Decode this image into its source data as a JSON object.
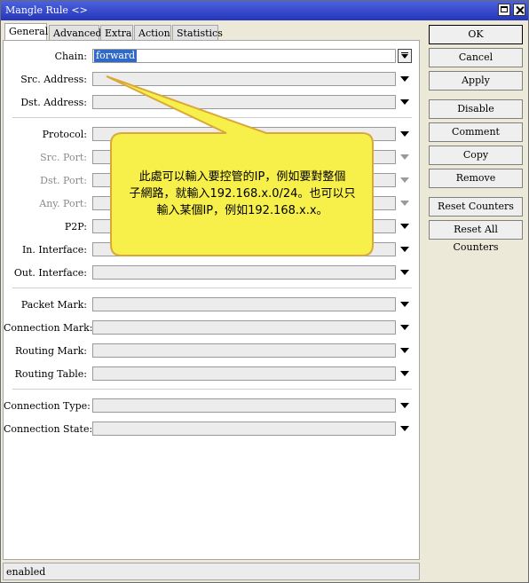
{
  "window": {
    "title": "Mangle Rule <>",
    "title_color": "#2e43cc"
  },
  "tabs": [
    {
      "label": "General",
      "active": true
    },
    {
      "label": "Advanced",
      "active": false
    },
    {
      "label": "Extra",
      "active": false
    },
    {
      "label": "Action",
      "active": false
    },
    {
      "label": "Statistics",
      "active": false
    }
  ],
  "fields": {
    "chain": {
      "label": "Chain:",
      "value": "forward"
    },
    "src_address": {
      "label": "Src. Address:"
    },
    "dst_address": {
      "label": "Dst. Address:"
    },
    "protocol": {
      "label": "Protocol:"
    },
    "src_port": {
      "label": "Src. Port:"
    },
    "dst_port": {
      "label": "Dst. Port:"
    },
    "any_port": {
      "label": "Any. Port:"
    },
    "p2p": {
      "label": "P2P:"
    },
    "in_interface": {
      "label": "In. Interface:"
    },
    "out_interface": {
      "label": "Out. Interface:"
    },
    "packet_mark": {
      "label": "Packet Mark:"
    },
    "connection_mark": {
      "label": "Connection Mark:"
    },
    "routing_mark": {
      "label": "Routing Mark:"
    },
    "routing_table": {
      "label": "Routing Table:"
    },
    "connection_type": {
      "label": "Connection Type:"
    },
    "connection_state": {
      "label": "Connection State:"
    }
  },
  "buttons": {
    "ok": "OK",
    "cancel": "Cancel",
    "apply": "Apply",
    "disable": "Disable",
    "comment": "Comment",
    "copy": "Copy",
    "remove": "Remove",
    "reset_counters": "Reset Counters",
    "reset_all_counters": "Reset All Counters"
  },
  "status": {
    "text": "enabled"
  },
  "callout": {
    "lines": [
      "此處可以輸入要控管的IP，例如要對整個",
      "子網路，就輸入192.168.x.0/24。也可以只",
      "輸入某個IP，例如192.168.x.x。"
    ],
    "fill_color": "#f7f04a",
    "border_color": "#d9a838"
  }
}
